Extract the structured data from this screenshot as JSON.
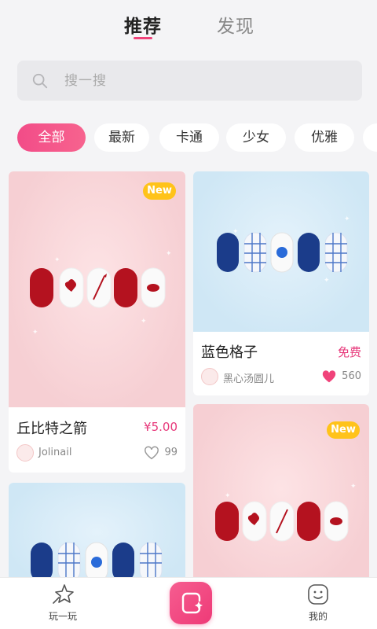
{
  "top_tabs": [
    {
      "label": "推荐",
      "active": true
    },
    {
      "label": "发现",
      "active": false
    }
  ],
  "search": {
    "placeholder": "搜一搜"
  },
  "categories": [
    {
      "label": "全部",
      "active": true
    },
    {
      "label": "最新",
      "active": false
    },
    {
      "label": "卡通",
      "active": false
    },
    {
      "label": "少女",
      "active": false
    },
    {
      "label": "优雅",
      "active": false
    }
  ],
  "cards": [
    {
      "title": "丘比特之箭",
      "price": "¥5.00",
      "author": "Jolinail",
      "likes": "99",
      "liked": false,
      "badge": "New",
      "theme": "pink"
    },
    {
      "title": "蓝色格子",
      "price": "免费",
      "author": "黑心汤圆儿",
      "likes": "560",
      "liked": true,
      "badge": "",
      "theme": "blue"
    },
    {
      "title": "",
      "price": "",
      "author": "",
      "likes": "",
      "liked": false,
      "badge": "",
      "theme": "blue"
    },
    {
      "title": "",
      "price": "",
      "author": "",
      "likes": "",
      "liked": false,
      "badge": "New",
      "theme": "pink"
    }
  ],
  "bottom_nav": [
    {
      "label": "玩一玩",
      "icon": "play-star-icon"
    },
    {
      "label": "",
      "icon": "create-nail-icon"
    },
    {
      "label": "我的",
      "icon": "smiley-face-icon"
    }
  ],
  "colors": {
    "accent": "#f0437a",
    "badge": "#ffc31a",
    "price": "#e7387a",
    "like_active": "#f0437a"
  }
}
